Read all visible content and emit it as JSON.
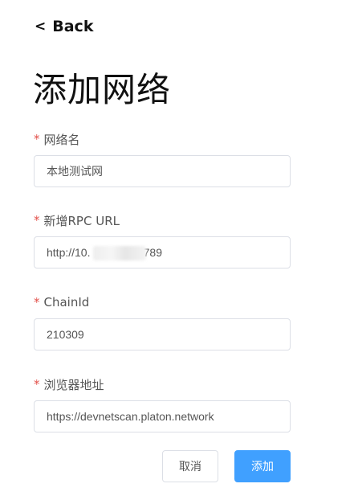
{
  "nav": {
    "back_label": "Back",
    "back_chevron": "<"
  },
  "page_title": "添加网络",
  "form": {
    "required_mark": "*",
    "network_name": {
      "label": "网络名",
      "value": "本地测试网"
    },
    "rpc_url": {
      "label": "新增RPC URL",
      "value": "http://10.          48:6789"
    },
    "chain_id": {
      "label": "ChainId",
      "value": "210309"
    },
    "explorer": {
      "label": "浏览器地址",
      "value": "https://devnetscan.platon.network"
    }
  },
  "actions": {
    "cancel_label": "取消",
    "add_label": "添加"
  },
  "colors": {
    "required": "#e2504a",
    "primary": "#40a0ff",
    "border": "#dcdfe6"
  }
}
